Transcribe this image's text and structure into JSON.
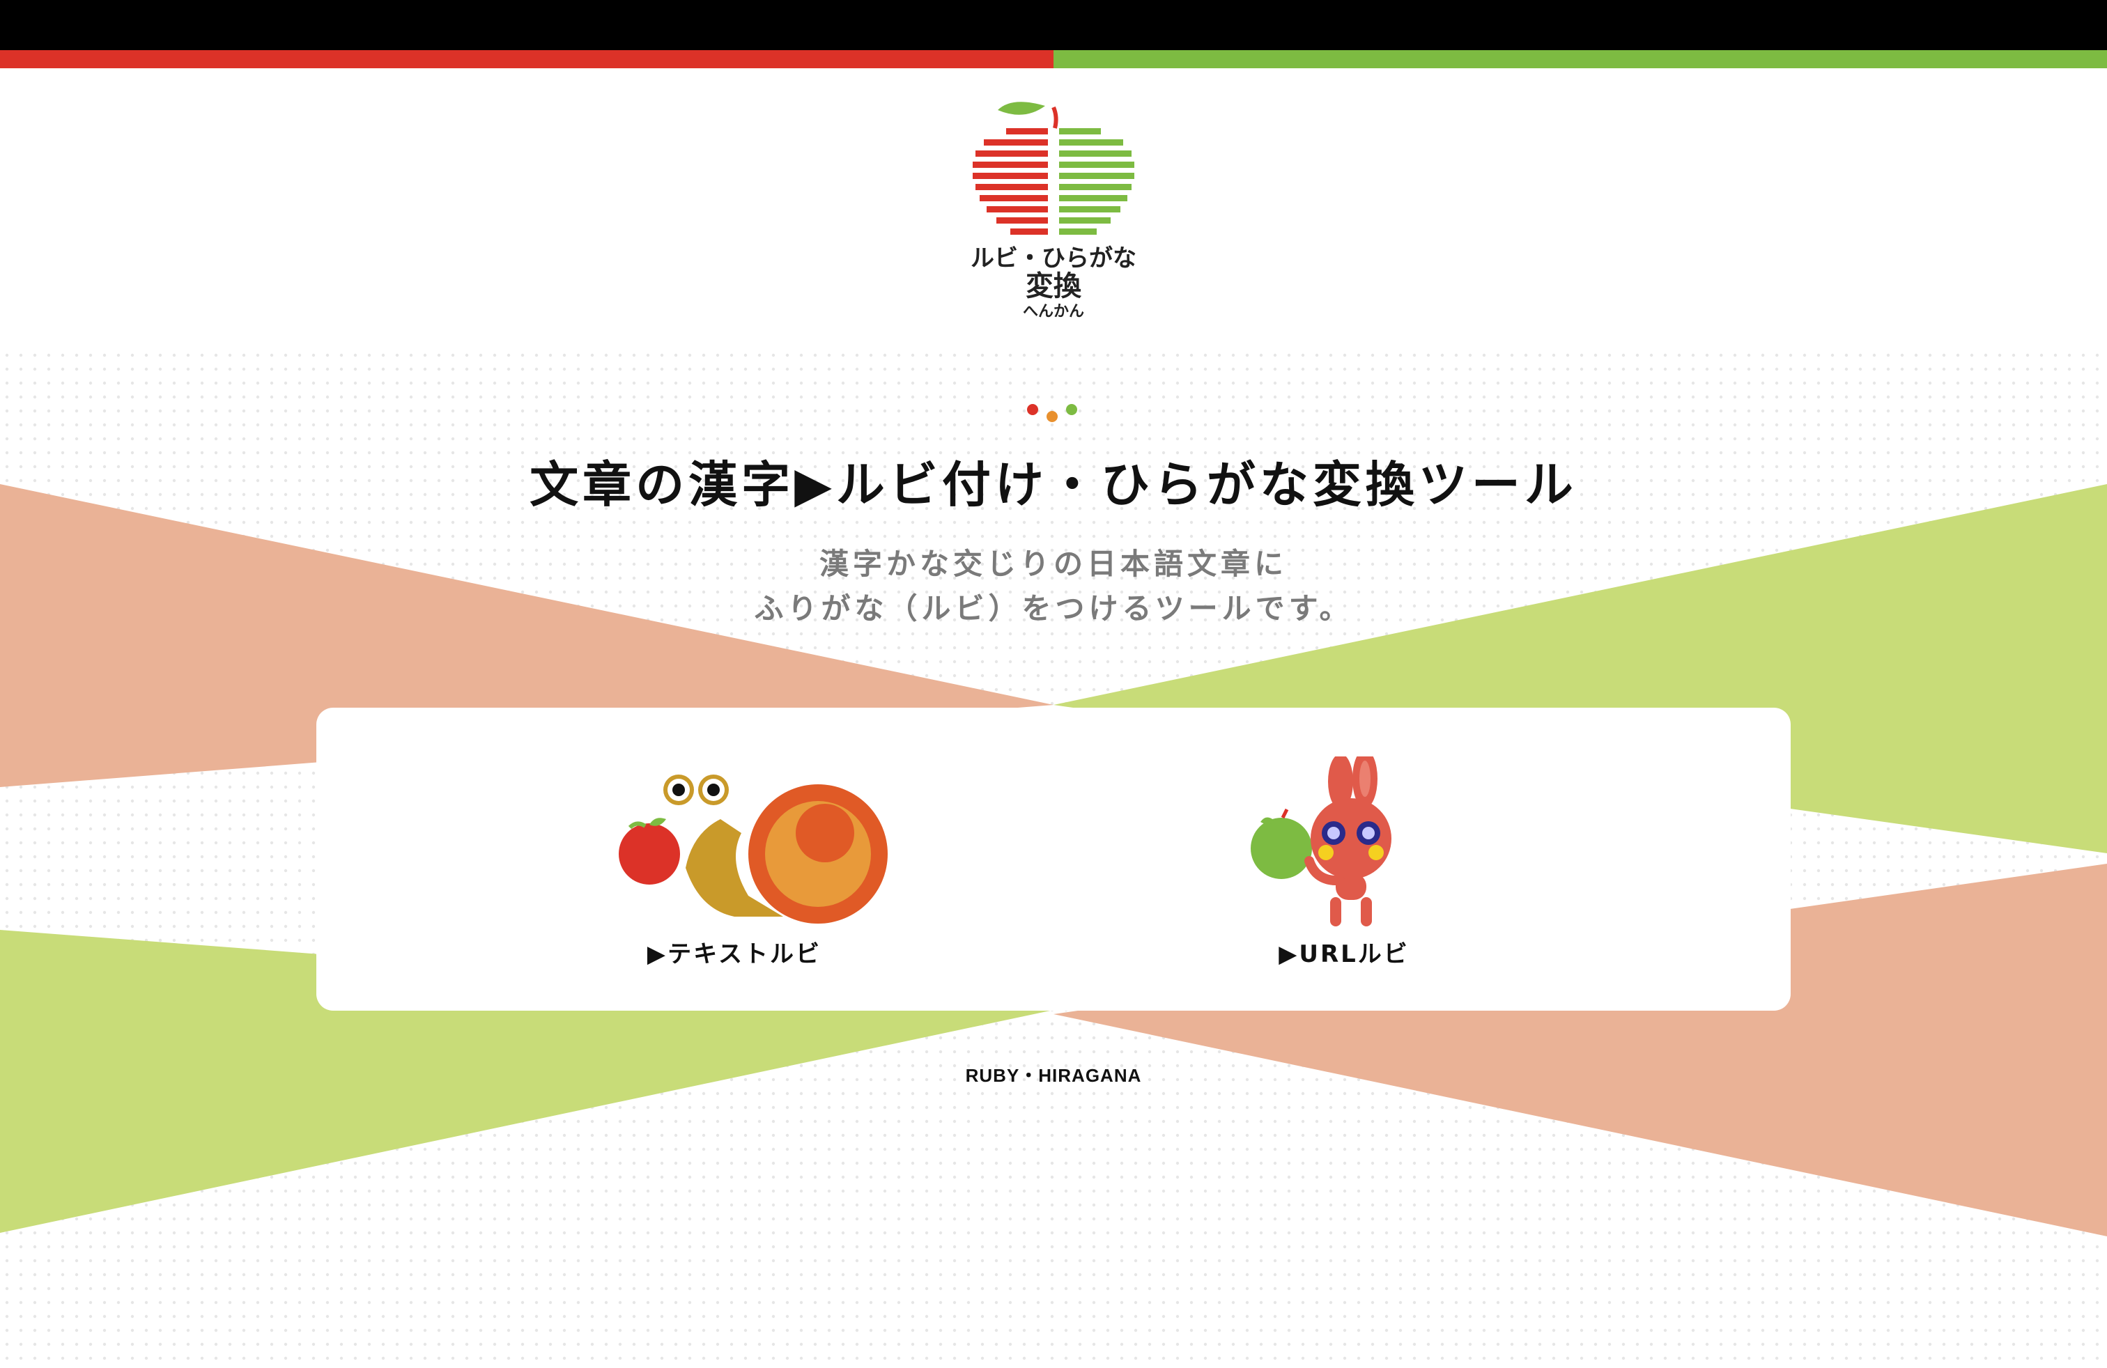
{
  "brand": {
    "logo_line1": "ルビ・ひらがな",
    "logo_line2": "変換",
    "logo_line3": "へんかん"
  },
  "hero": {
    "headline": "文章の漢字▶ルビ付け・ひらがな変換ツール",
    "subtext_line1": "漢字かな交じりの日本語文章に",
    "subtext_line2": "ふりがな（ルビ）をつけるツールです。"
  },
  "tools": [
    {
      "label": "▶テキストルビ",
      "icon": "snail-with-apple-icon"
    },
    {
      "label": "▶URLルビ",
      "icon": "rabbit-with-apple-icon"
    }
  ],
  "footer": {
    "label": "RUBY・HIRAGANA"
  },
  "colors": {
    "red": "#dc3228",
    "green": "#7dbb42",
    "peach": "#eab296",
    "lime": "#c8dc78",
    "black": "#000000"
  }
}
